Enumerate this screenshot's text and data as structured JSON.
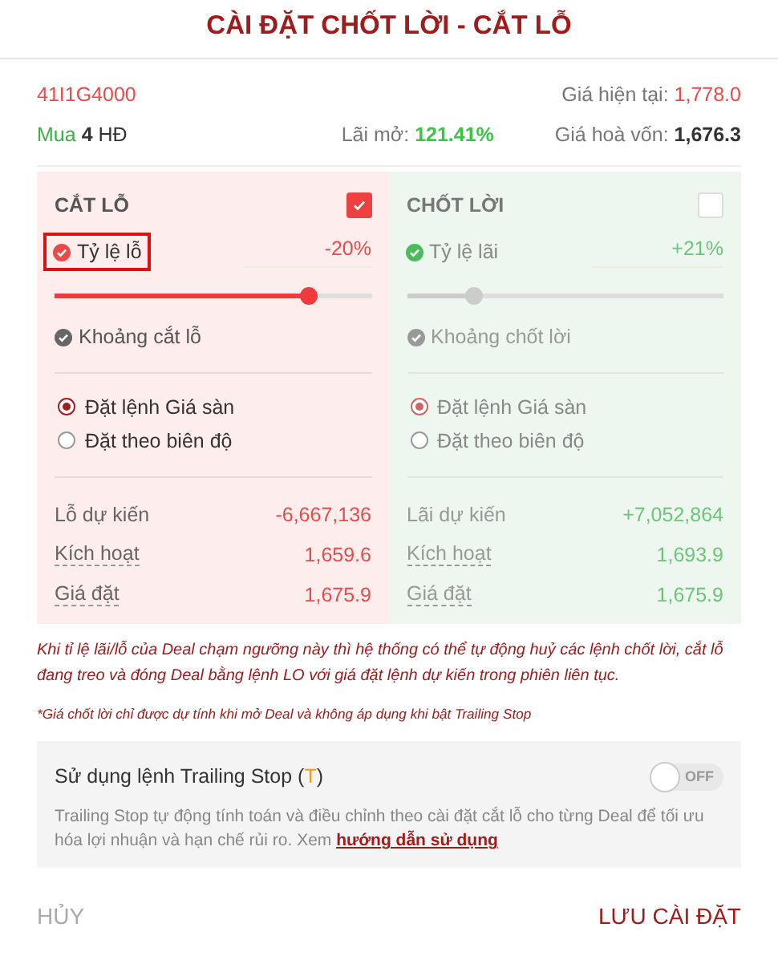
{
  "title": "CÀI ĐẶT CHỐT LỜI - CẮT LỖ",
  "summary": {
    "symbol": "41I1G4000",
    "current_price_label": "Giá hiện tại:",
    "current_price": "1,778.0",
    "side": "Mua",
    "quantity": "4",
    "unit": "HĐ",
    "open_profit_label": "Lãi mở:",
    "open_profit": "121.41%",
    "breakeven_label": "Giá hoà vốn:",
    "breakeven": "1,676.3"
  },
  "panels": [
    {
      "kind": "loss",
      "title": "CẮT LỖ",
      "checked": true,
      "rate_label": "Tỷ lệ lỗ",
      "rate_value": "-20%",
      "rate_highlighted": true,
      "level": 0.8,
      "range_label": "Khoảng cắt lỗ",
      "options": [
        {
          "label": "Đặt lệnh Giá sàn",
          "selected": true
        },
        {
          "label": "Đặt theo biên độ",
          "selected": false
        }
      ],
      "rows": [
        {
          "label": "Lỗ dự kiến",
          "value": "-6,667,136",
          "underlined": false
        },
        {
          "label": "Kích hoạt",
          "value": "1,659.6",
          "underlined": true
        },
        {
          "label": "Giá đặt",
          "value": "1,675.9",
          "underlined": true
        }
      ]
    },
    {
      "kind": "profit",
      "title": "CHỐT LỜI",
      "checked": false,
      "rate_label": "Tỷ lệ lãi",
      "rate_value": "+21%",
      "rate_highlighted": false,
      "level": 0.21,
      "range_label": "Khoảng chốt lời",
      "options": [
        {
          "label": "Đặt lệnh Giá sàn",
          "selected": true
        },
        {
          "label": "Đặt theo biên độ",
          "selected": false
        }
      ],
      "rows": [
        {
          "label": "Lãi dự kiến",
          "value": "+7,052,864",
          "underlined": false
        },
        {
          "label": "Kích hoạt",
          "value": "1,693.9",
          "underlined": true
        },
        {
          "label": "Giá đặt",
          "value": "1,675.9",
          "underlined": true
        }
      ]
    }
  ],
  "notes": [
    "Khi tỉ lệ lãi/lỗ của Deal chạm ngưỡng này thì hệ thống có thể tự động huỷ các lệnh chốt lời, cắt lỗ đang treo và đóng Deal bằng lệnh LO với giá đặt lệnh dự kiến trong phiên liên tục.",
    "*Giá chốt lời chỉ được dự tính khi mở Deal và không áp dụng khi bật Trailing Stop"
  ],
  "trailing": {
    "title_before": "Sử dụng lệnh Trailing Stop (",
    "title_mark": "T",
    "title_after": ")",
    "on": false,
    "toggle_label": "OFF",
    "description": "Trailing Stop tự động tính toán và điều chỉnh theo cài đặt cắt lỗ cho từng Deal để tối ưu hóa lợi nhuận và hạn chế rủi ro. Xem",
    "link": "hướng dẫn sử dụng"
  },
  "buttons": {
    "cancel": "HỦY",
    "save": "LƯU CÀI ĐẶT"
  }
}
